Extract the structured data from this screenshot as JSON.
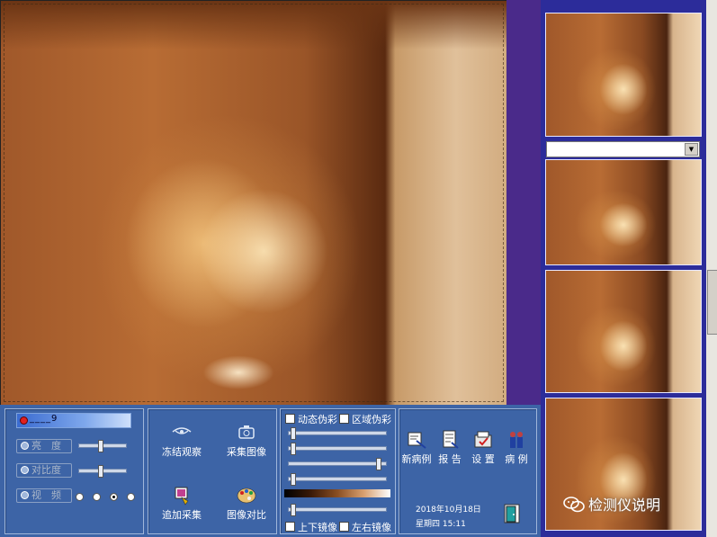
{
  "viewer": {
    "name": "main-video-view"
  },
  "thumbnails": {
    "count": 4,
    "select_value": ""
  },
  "controls": {
    "counter_value": "____9",
    "brightness_label": "亮　度",
    "contrast_label": "对比度",
    "video_label": "视　频",
    "brightness_level": 0.45,
    "contrast_level": 0.45,
    "video_options_count": 4,
    "video_selected_index": 2
  },
  "capture": {
    "freeze_label": "冻结观察",
    "capture_label": "采集图像",
    "append_label": "追加采集",
    "compare_label": "图像对比"
  },
  "color": {
    "dynamic_pseudo_label": "动态伪彩",
    "region_pseudo_label": "区域伪彩",
    "slider_levels": [
      0.02,
      0.02,
      0.95,
      0.02
    ],
    "bottom_slider_level": 0.02,
    "flip_vertical_label": "上下镜像",
    "flip_horizontal_label": "左右镜像"
  },
  "case": {
    "new_case_label": "新病例",
    "report_label": "报 告",
    "settings_label": "设 置",
    "cases_label": "病 例",
    "date": "2018年10月18日",
    "weekday_time": "星期四 15:11"
  },
  "watermark": {
    "text": "检测仪说明"
  },
  "colors": {
    "panel_bg": "#3d64a6",
    "thumb_bg": "#2c2c9a",
    "divider_bg": "#4a2a8a"
  }
}
